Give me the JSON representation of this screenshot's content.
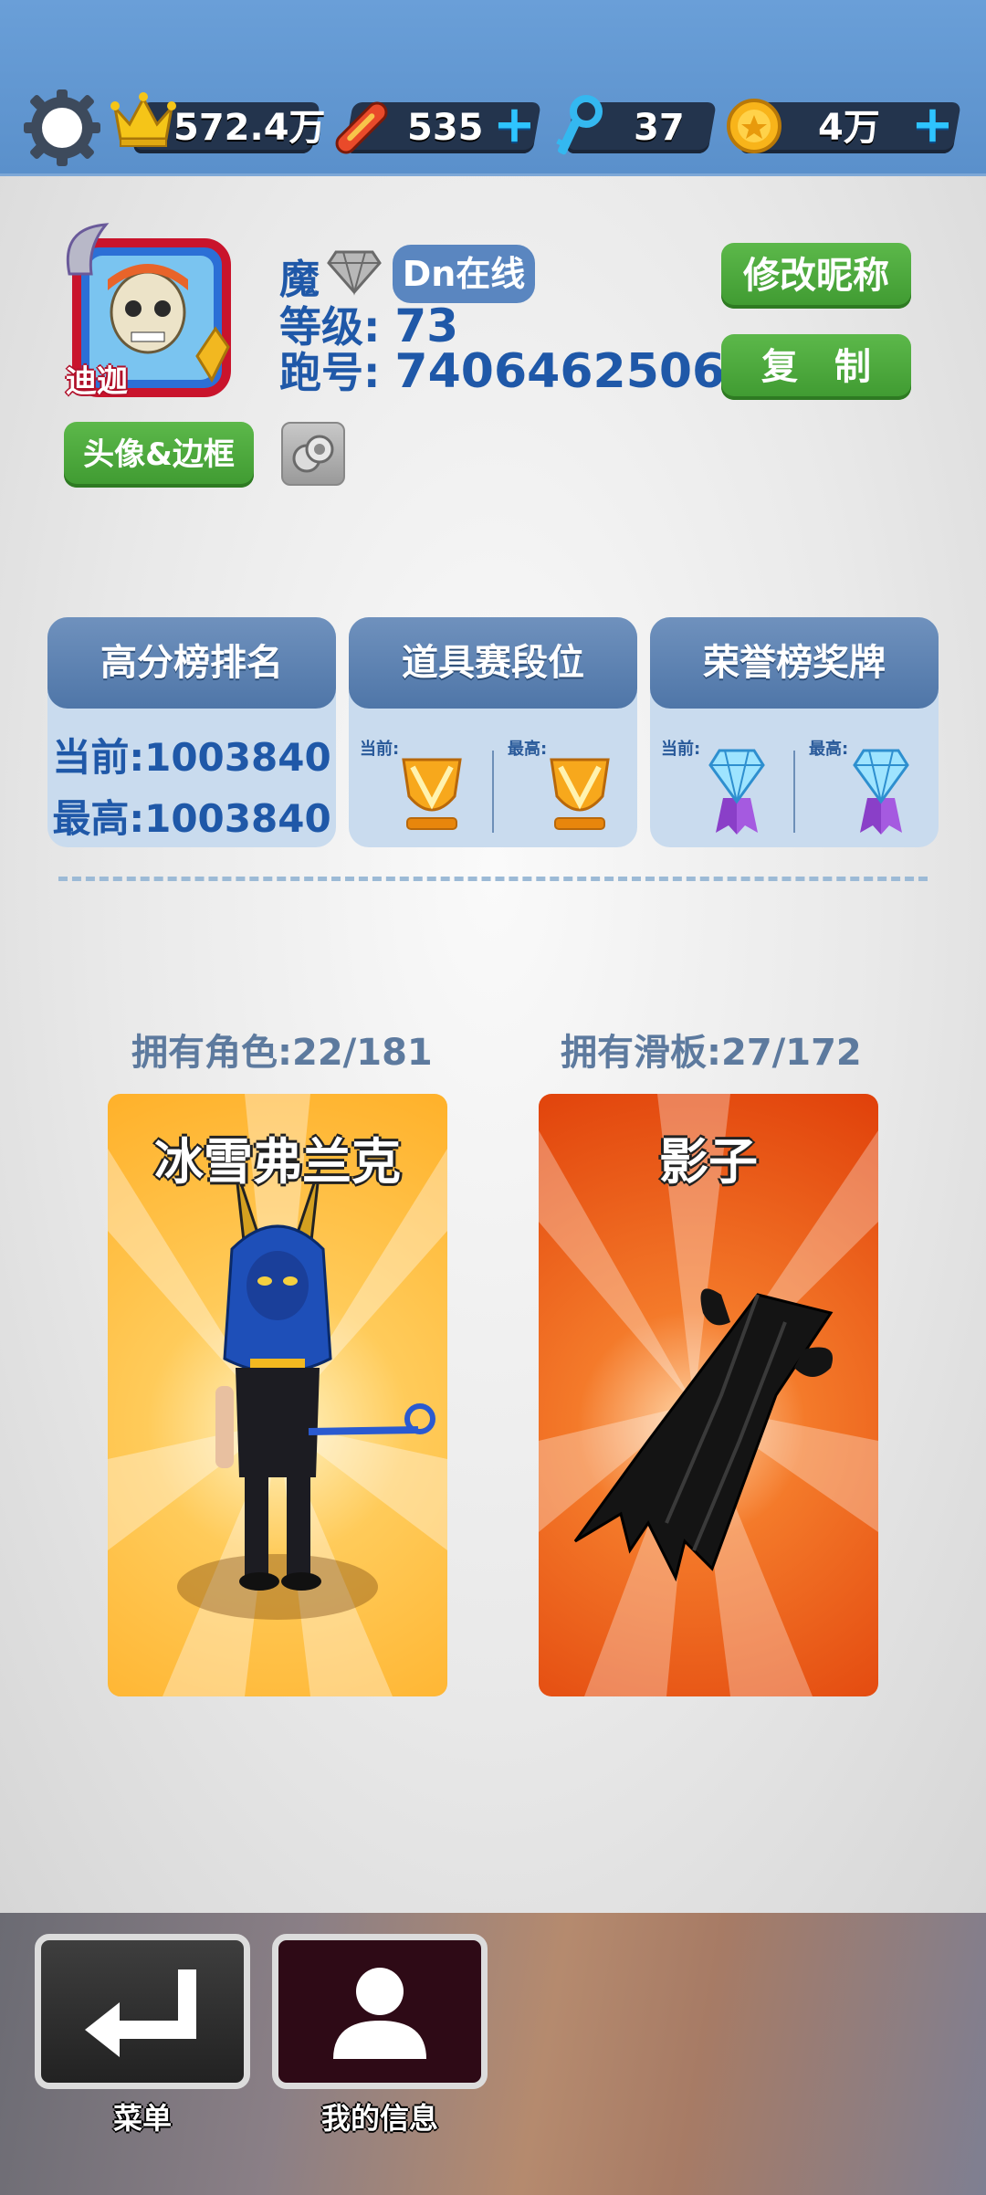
{
  "topbar": {
    "score": "572.4万",
    "boards": "535",
    "keys": "37",
    "coins": "4万",
    "plus_symbol": "+"
  },
  "profile": {
    "name": "魔",
    "status_badge": "Dn在线",
    "level_label": "等级:",
    "level_value": "73",
    "id_label": "跑号:",
    "id_value": "7406462506",
    "avatar_label": "迪迦",
    "rename_button": "修改昵称",
    "copy_button": "复　制",
    "avatar_frame_button": "头像&边框"
  },
  "stats": {
    "highscore_title": "高分榜排名",
    "current_line": "当前:1003840",
    "best_line": "最高:1003840",
    "powerup_title": "道具赛段位",
    "honor_title": "荣誉榜奖牌",
    "current_small": "当前:",
    "best_small": "最高:"
  },
  "collection": {
    "characters_owned": "拥有角色:22/181",
    "boards_owned": "拥有滑板:27/172",
    "character_name": "冰雪弗兰克",
    "board_name": "影子"
  },
  "nav": {
    "menu_label": "菜单",
    "myinfo_label": "我的信息"
  },
  "colors": {
    "top_bar": "#5f95cf",
    "green_button": "#4aa83a",
    "card_header": "#5a80b0",
    "character_card": "#ffb635",
    "board_card": "#e2410c"
  }
}
